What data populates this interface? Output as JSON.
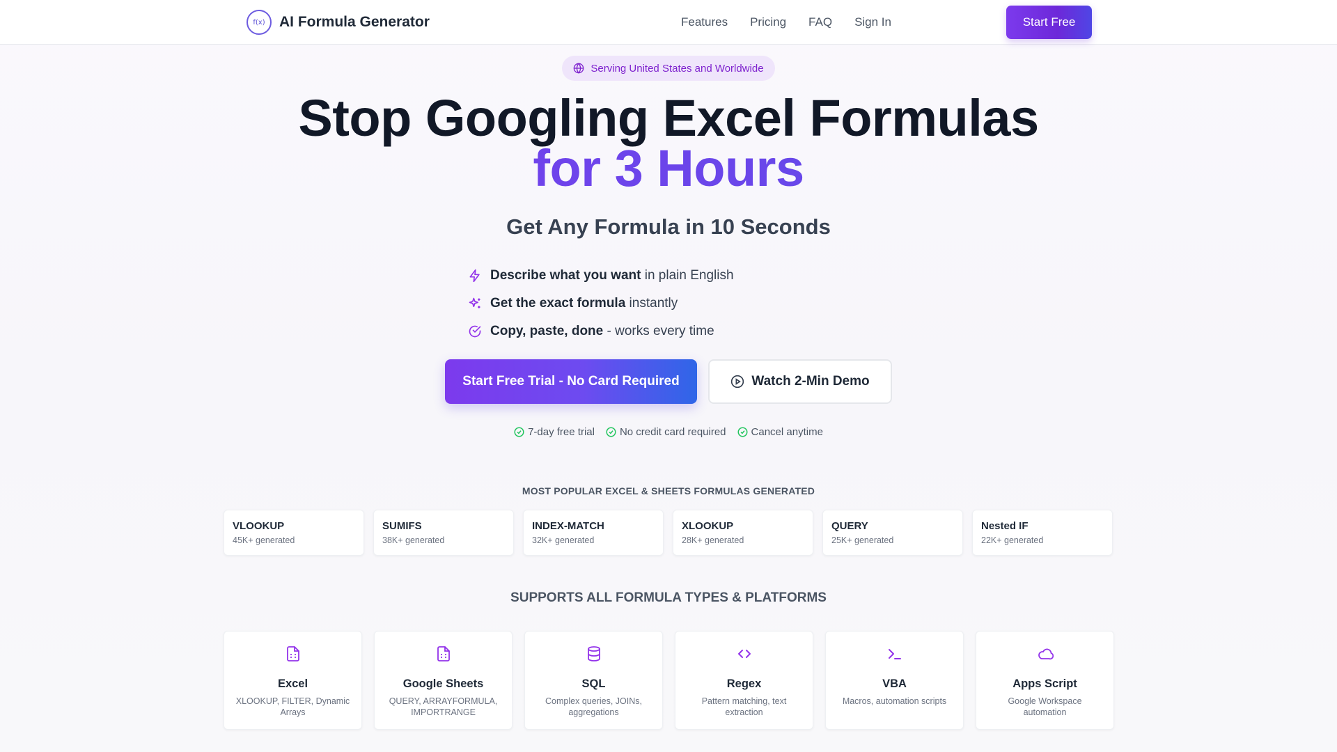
{
  "header": {
    "logo_mark": "f(x)",
    "brand": "AI Formula Generator",
    "nav": [
      "Features",
      "Pricing",
      "FAQ",
      "Sign In"
    ],
    "cta": "Start Free"
  },
  "badge": {
    "text": "Serving United States and Worldwide",
    "icon": "globe-icon"
  },
  "hero": {
    "title_line1": "Stop Googling Excel Formulas",
    "title_line2": "for 3 Hours",
    "subtitle": "Get Any Formula in 10 Seconds",
    "points": [
      {
        "icon": "lightning-icon",
        "bold": "Describe what you want",
        "rest": " in plain English"
      },
      {
        "icon": "sparkles-icon",
        "bold": "Get the exact formula",
        "rest": " instantly"
      },
      {
        "icon": "check-circle-icon",
        "bold": "Copy, paste, done",
        "rest": " - works every time"
      }
    ],
    "primary_cta": "Start Free Trial - No Card Required",
    "secondary_cta": "Watch 2-Min Demo",
    "guarantees": [
      "7-day free trial",
      "No credit card required",
      "Cancel anytime"
    ]
  },
  "popular": {
    "label": "MOST POPULAR EXCEL & SHEETS FORMULAS GENERATED",
    "items": [
      {
        "name": "VLOOKUP",
        "count": "45K+ generated"
      },
      {
        "name": "SUMIFS",
        "count": "38K+ generated"
      },
      {
        "name": "INDEX-MATCH",
        "count": "32K+ generated"
      },
      {
        "name": "XLOOKUP",
        "count": "28K+ generated"
      },
      {
        "name": "QUERY",
        "count": "25K+ generated"
      },
      {
        "name": "Nested IF",
        "count": "22K+ generated"
      }
    ]
  },
  "platforms": {
    "label": "SUPPORTS ALL FORMULA TYPES & PLATFORMS",
    "items": [
      {
        "icon": "spreadsheet-file-icon",
        "name": "Excel",
        "desc": "XLOOKUP, FILTER, Dynamic Arrays"
      },
      {
        "icon": "spreadsheet-file-icon",
        "name": "Google Sheets",
        "desc": "QUERY, ARRAYFORMULA, IMPORTRANGE"
      },
      {
        "icon": "database-icon",
        "name": "SQL",
        "desc": "Complex queries, JOINs, aggregations"
      },
      {
        "icon": "code-icon",
        "name": "Regex",
        "desc": "Pattern matching, text extraction"
      },
      {
        "icon": "terminal-icon",
        "name": "VBA",
        "desc": "Macros, automation scripts"
      },
      {
        "icon": "cloud-icon",
        "name": "Apps Script",
        "desc": "Google Workspace automation"
      }
    ]
  },
  "colors": {
    "accent": "#7c3aed",
    "accent_blue": "#2f66e8",
    "success": "#22c55e"
  }
}
